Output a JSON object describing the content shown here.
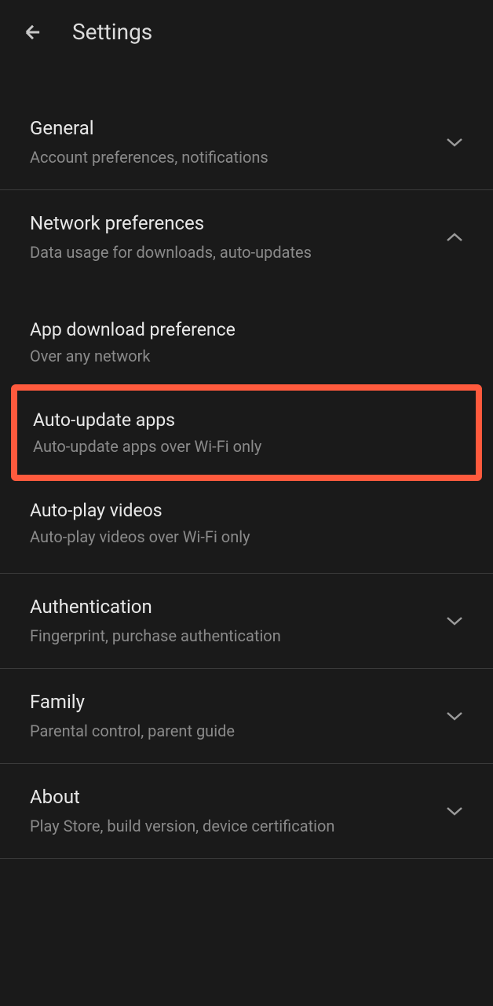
{
  "header": {
    "title": "Settings"
  },
  "sections": {
    "general": {
      "title": "General",
      "subtitle": "Account preferences, notifications",
      "expanded": false
    },
    "network": {
      "title": "Network preferences",
      "subtitle": "Data usage for downloads, auto-updates",
      "expanded": true,
      "items": {
        "download": {
          "title": "App download preference",
          "subtitle": "Over any network"
        },
        "autoupdate": {
          "title": "Auto-update apps",
          "subtitle": "Auto-update apps over Wi-Fi only",
          "highlighted": true
        },
        "autoplay": {
          "title": "Auto-play videos",
          "subtitle": "Auto-play videos over Wi-Fi only"
        }
      }
    },
    "authentication": {
      "title": "Authentication",
      "subtitle": "Fingerprint, purchase authentication",
      "expanded": false
    },
    "family": {
      "title": "Family",
      "subtitle": "Parental control, parent guide",
      "expanded": false
    },
    "about": {
      "title": "About",
      "subtitle": "Play Store, build version, device certification",
      "expanded": false
    }
  }
}
